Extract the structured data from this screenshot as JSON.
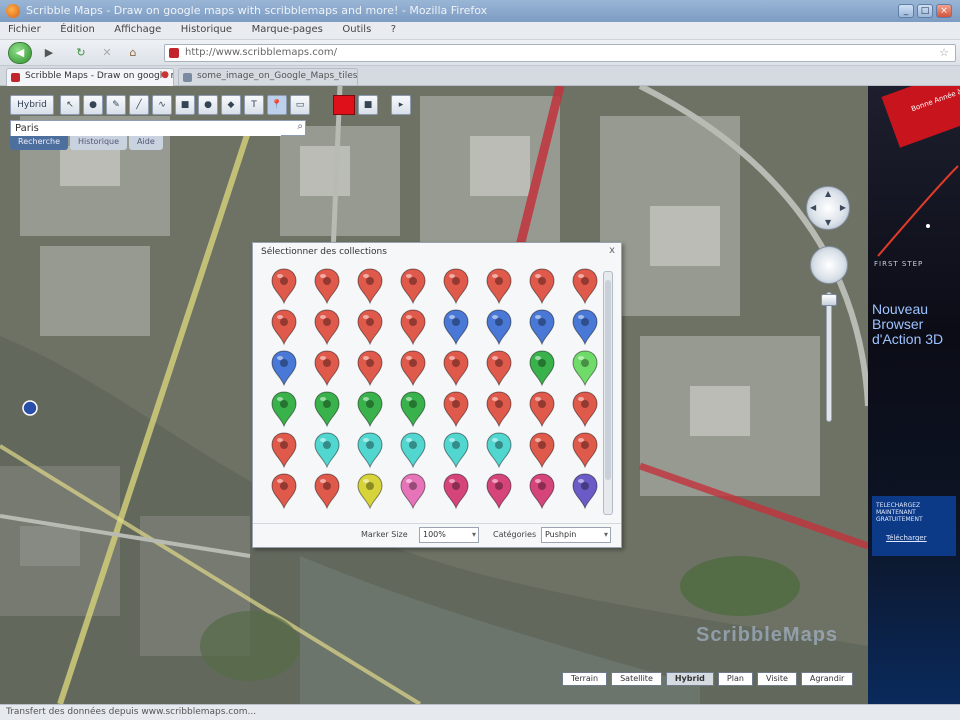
{
  "window": {
    "title": "Scribble Maps - Draw on google maps with scribblemaps and more! - Mozilla Firefox"
  },
  "menu": [
    "Fichier",
    "Édition",
    "Affichage",
    "Historique",
    "Marque-pages",
    "Outils",
    "?"
  ],
  "nav": {
    "url": "http://www.scribblemaps.com/"
  },
  "tabs": [
    {
      "label": "Scribble Maps - Draw on google maps..."
    },
    {
      "label": "some_image_on_Google_Maps_tiles"
    }
  ],
  "map_toolbar": {
    "map_type_label": "Hybrid",
    "search_value": "Paris",
    "subtabs": [
      "Recherche",
      "Historique",
      "Aide"
    ]
  },
  "dialog": {
    "title": "Sélectionner des collections",
    "close": "x",
    "size_label": "Marker Size",
    "size_value": "100%",
    "category_label": "Catégories",
    "category_value": "Pushpin",
    "marker_colors": [
      [
        "#e05a4c",
        "#e05a4c",
        "#e05a4c",
        "#e05a4c",
        "#e05a4c",
        "#e05a4c",
        "#e05a4c",
        "#e05a4c"
      ],
      [
        "#e05a4c",
        "#e05a4c",
        "#e05a4c",
        "#e05a4c",
        "#4a78d6",
        "#4a78d6",
        "#4a78d6",
        "#4a78d6"
      ],
      [
        "#4a78d6",
        "#e05a4c",
        "#e05a4c",
        "#e05a4c",
        "#e05a4c",
        "#e05a4c",
        "#39b24b",
        "#6fdc6a"
      ],
      [
        "#39b24b",
        "#39b24b",
        "#39b24b",
        "#39b24b",
        "#e05a4c",
        "#e05a4c",
        "#e05a4c",
        "#e05a4c"
      ],
      [
        "#e05a4c",
        "#52d6d0",
        "#52d6d0",
        "#52d6d0",
        "#52d6d0",
        "#52d6d0",
        "#e05a4c",
        "#e05a4c"
      ],
      [
        "#e05a4c",
        "#e05a4c",
        "#d6d43a",
        "#e774b8",
        "#d6457a",
        "#d6457a",
        "#d6457a",
        "#6b5bc6"
      ]
    ]
  },
  "map_modes": [
    "Terrain",
    "Satellite",
    "Hybrid",
    "Plan",
    "Visite",
    "Agrandir"
  ],
  "map_watermark": "ScribbleMaps",
  "ad": {
    "ribbon": "Bonne Année à tous!",
    "brand": "FIRST STEP",
    "headline": "Nouveau Browser d'Action 3D",
    "box_text": "TELECHARGEZ MAINTENANT GRATUITEMENT",
    "box_link": "Télécharger"
  },
  "status": "Transfert des données depuis www.scribblemaps.com..."
}
